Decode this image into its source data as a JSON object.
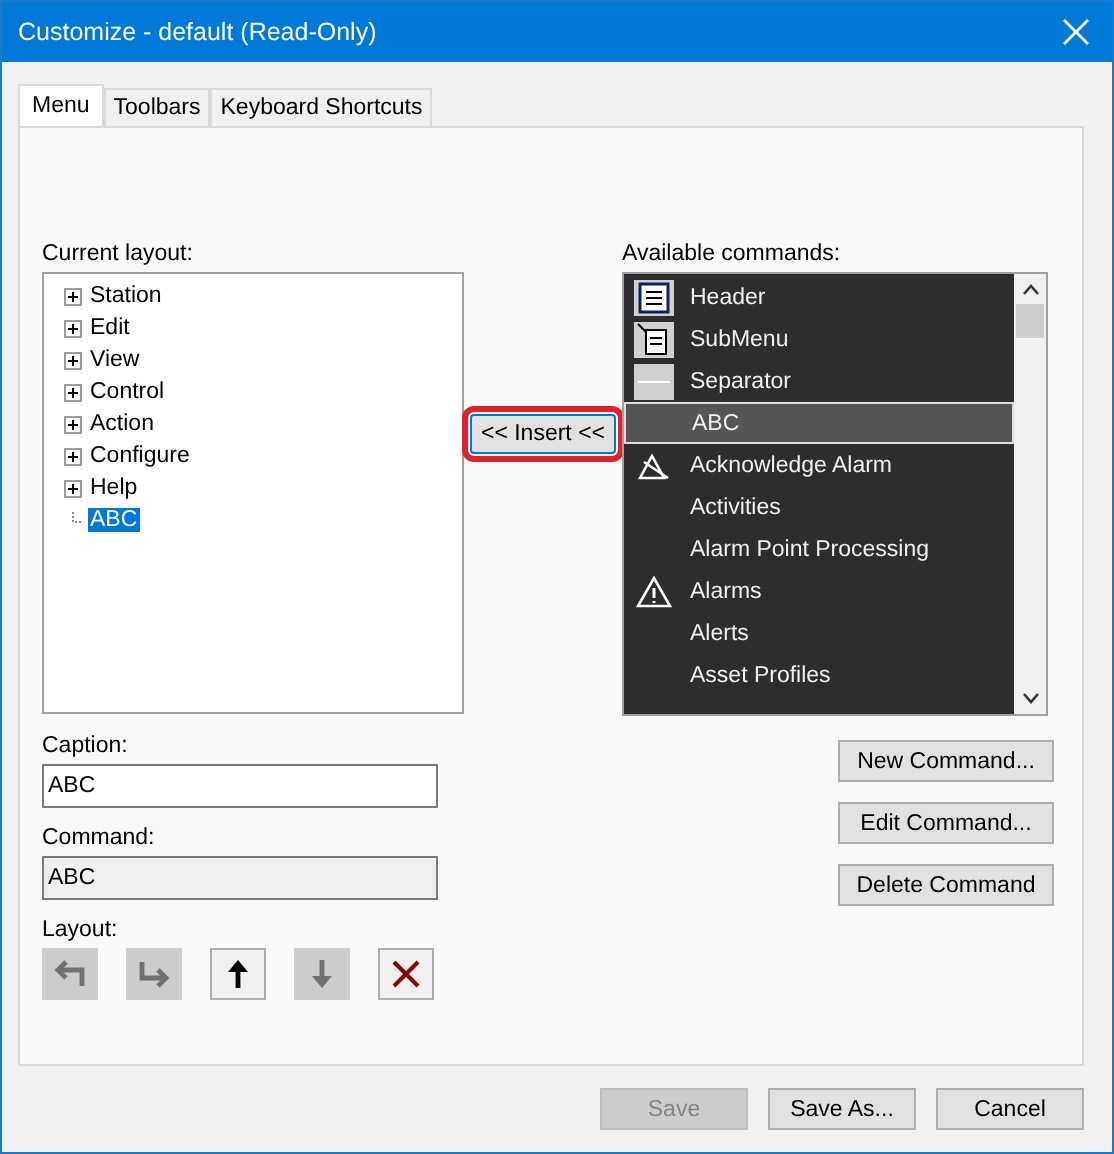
{
  "window": {
    "title": "Customize - default (Read-Only)"
  },
  "tabs": [
    {
      "label": "Menu",
      "selected": true
    },
    {
      "label": "Toolbars",
      "selected": false
    },
    {
      "label": "Keyboard Shortcuts",
      "selected": false
    }
  ],
  "current_layout": {
    "label": "Current layout:",
    "items": [
      {
        "label": "Station",
        "expandable": true,
        "selected": false
      },
      {
        "label": "Edit",
        "expandable": true,
        "selected": false
      },
      {
        "label": "View",
        "expandable": true,
        "selected": false
      },
      {
        "label": "Control",
        "expandable": true,
        "selected": false
      },
      {
        "label": "Action",
        "expandable": true,
        "selected": false
      },
      {
        "label": "Configure",
        "expandable": true,
        "selected": false
      },
      {
        "label": "Help",
        "expandable": true,
        "selected": false
      },
      {
        "label": "ABC",
        "expandable": false,
        "selected": true
      }
    ]
  },
  "insert_button": {
    "label": "<< Insert <<",
    "highlighted": true
  },
  "available_commands": {
    "label": "Available commands:",
    "items": [
      {
        "label": "Header",
        "kind": "header",
        "selected": false
      },
      {
        "label": "SubMenu",
        "kind": "submenu",
        "selected": false
      },
      {
        "label": "Separator",
        "kind": "separator",
        "selected": false
      },
      {
        "label": "ABC",
        "kind": "none",
        "selected": true
      },
      {
        "label": "Acknowledge Alarm",
        "kind": "acknowledge",
        "selected": false
      },
      {
        "label": "Activities",
        "kind": "none",
        "selected": false
      },
      {
        "label": "Alarm Point Processing",
        "kind": "none",
        "selected": false
      },
      {
        "label": "Alarms",
        "kind": "warning",
        "selected": false
      },
      {
        "label": "Alerts",
        "kind": "none",
        "selected": false
      },
      {
        "label": "Asset Profiles",
        "kind": "none",
        "selected": false
      }
    ]
  },
  "caption": {
    "label": "Caption:",
    "value": "ABC",
    "disabled": false
  },
  "command": {
    "label": "Command:",
    "value": "ABC",
    "disabled": true
  },
  "layout": {
    "label": "Layout:",
    "buttons": [
      {
        "kind": "left",
        "disabled": true
      },
      {
        "kind": "right",
        "disabled": true
      },
      {
        "kind": "up",
        "disabled": false
      },
      {
        "kind": "down",
        "disabled": true
      },
      {
        "kind": "delete",
        "disabled": false
      }
    ]
  },
  "command_buttons": [
    {
      "label": "New Command...",
      "disabled": false
    },
    {
      "label": "Edit Command...",
      "disabled": false
    },
    {
      "label": "Delete Command",
      "disabled": false
    }
  ],
  "footer_buttons": [
    {
      "label": "Save",
      "disabled": true
    },
    {
      "label": "Save As...",
      "disabled": false
    },
    {
      "label": "Cancel",
      "disabled": false
    }
  ]
}
